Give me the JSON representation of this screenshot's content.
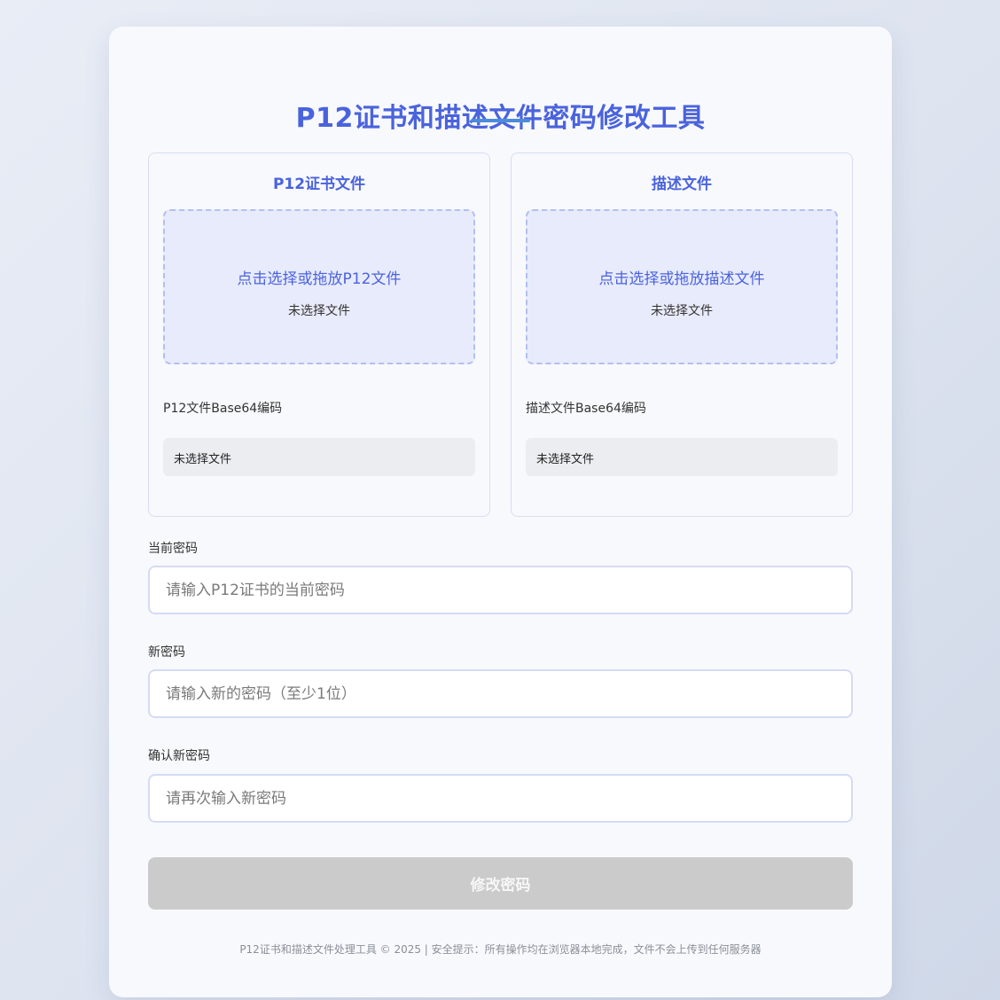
{
  "header": {
    "title": "P12证书和描述文件密码修改工具"
  },
  "p12_panel": {
    "title": "P12证书文件",
    "drop_label": "点击选择或拖放P12文件",
    "file_status": "未选择文件",
    "base64_label": "P12文件Base64编码",
    "base64_value": "未选择文件"
  },
  "profile_panel": {
    "title": "描述文件",
    "drop_label": "点击选择或拖放描述文件",
    "file_status": "未选择文件",
    "base64_label": "描述文件Base64编码",
    "base64_value": "未选择文件"
  },
  "form": {
    "current_password": {
      "label": "当前密码",
      "placeholder": "请输入P12证书的当前密码",
      "value": ""
    },
    "new_password": {
      "label": "新密码",
      "placeholder": "请输入新的密码（至少1位）",
      "value": ""
    },
    "confirm_password": {
      "label": "确认新密码",
      "placeholder": "请再次输入新密码",
      "value": ""
    },
    "submit_label": "修改密码"
  },
  "footer": {
    "text": "P12证书和描述文件处理工具 © 2025 | 安全提示：所有操作均在浏览器本地完成，文件不会上传到任何服务器"
  },
  "colors": {
    "accent": "#4a63dd",
    "underline": "#4c8bd9",
    "dropzone_bg": "#e8ebfb",
    "button_disabled": "#cbcbcb"
  }
}
